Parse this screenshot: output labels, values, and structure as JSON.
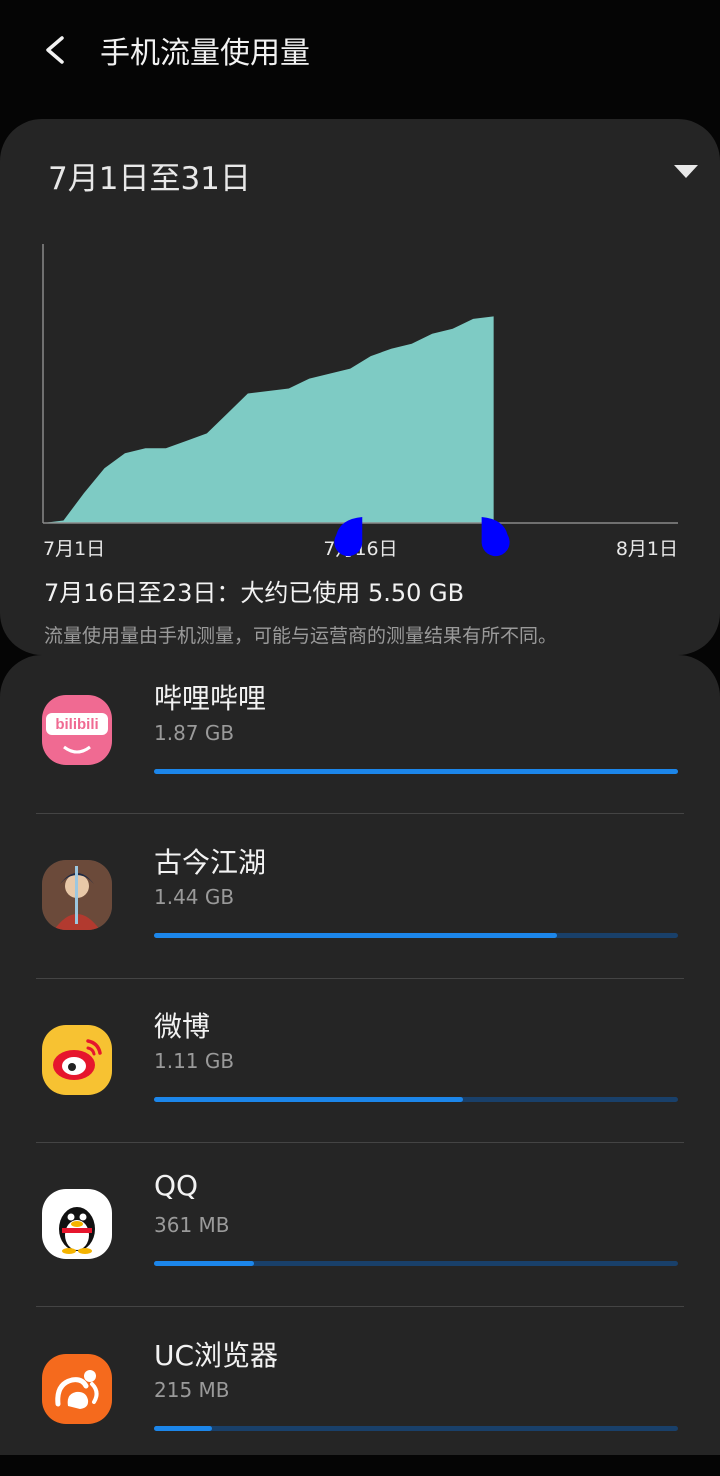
{
  "header": {
    "title": "手机流量使用量"
  },
  "period": {
    "label": "7月1日至31日"
  },
  "chart_data": {
    "type": "area",
    "x_ticks": [
      "7月1日",
      "7月16日",
      "8月1日"
    ],
    "x_days": [
      1,
      2,
      3,
      4,
      5,
      6,
      7,
      8,
      9,
      10,
      11,
      12,
      13,
      14,
      15,
      16,
      17,
      18,
      19,
      20,
      21,
      22,
      23,
      24,
      25,
      26,
      27,
      28,
      29,
      30,
      31,
      32
    ],
    "cumulative_relative": [
      0,
      0.01,
      0.12,
      0.22,
      0.28,
      0.3,
      0.3,
      0.33,
      0.36,
      0.44,
      0.52,
      0.53,
      0.54,
      0.58,
      0.6,
      0.62,
      0.67,
      0.7,
      0.72,
      0.76,
      0.78,
      0.82,
      0.83,
      null,
      null,
      null,
      null,
      null,
      null,
      null,
      null,
      null
    ],
    "selected_range": [
      "7月16日",
      "7月23日"
    ],
    "fill_color": "#7ecbc4",
    "handle_color": "#0000ff"
  },
  "usage": {
    "summary": "7月16日至23日：大约已使用 5.50 GB",
    "note": "流量使用量由手机测量，可能与运营商的测量结果有所不同。"
  },
  "apps": [
    {
      "name": "哔哩哔哩",
      "size": "1.87 GB",
      "fraction": 1.0,
      "icon": "bilibili-app-icon"
    },
    {
      "name": "古今江湖",
      "size": "1.44 GB",
      "fraction": 0.77,
      "icon": "gujinjianghu-app-icon"
    },
    {
      "name": "微博",
      "size": "1.11 GB",
      "fraction": 0.59,
      "icon": "weibo-app-icon"
    },
    {
      "name": "QQ",
      "size": "361 MB",
      "fraction": 0.19,
      "icon": "qq-app-icon"
    },
    {
      "name": "UC浏览器",
      "size": "215 MB",
      "fraction": 0.11,
      "icon": "uc-browser-app-icon"
    }
  ],
  "icons": {
    "back": "back-arrow-icon",
    "dropdown": "dropdown-triangle-icon"
  },
  "colors": {
    "bar_fill": "#1c86ea",
    "bar_track": "#19406a",
    "card": "#252525",
    "background": "#050505"
  }
}
